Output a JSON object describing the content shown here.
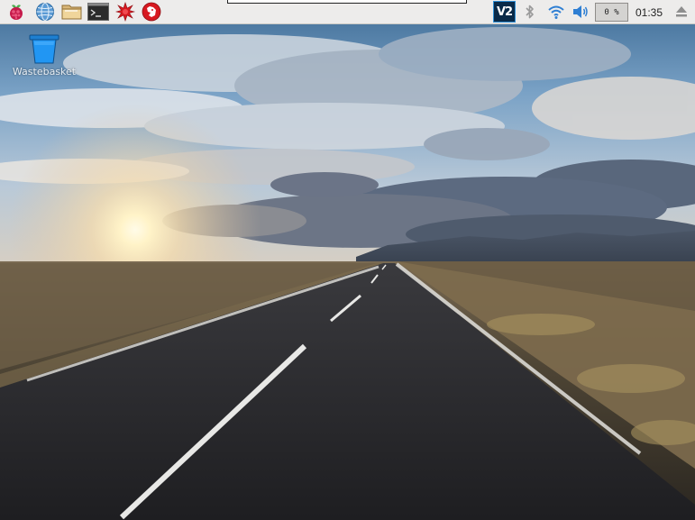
{
  "taskbar": {
    "launchers": [
      {
        "name": "raspberry-menu",
        "icon": "raspberry-pi-icon"
      },
      {
        "name": "web-browser",
        "icon": "globe-icon"
      },
      {
        "name": "file-manager",
        "icon": "folder-icon"
      },
      {
        "name": "terminal",
        "icon": "terminal-icon"
      },
      {
        "name": "math-kernel",
        "icon": "red-star-icon"
      },
      {
        "name": "wolfram",
        "icon": "wolf-icon"
      }
    ],
    "tray": {
      "vnc_label": "V2",
      "cpu_usage": "0 %",
      "clock": "01:35"
    }
  },
  "desktop": {
    "icons": [
      {
        "label": "Wastebasket",
        "icon": "wastebasket-icon"
      }
    ]
  },
  "colors": {
    "taskbar_bg": "#edeceb",
    "vnc_bg": "#0a2a48",
    "trash_blue": "#1e7fd0"
  }
}
